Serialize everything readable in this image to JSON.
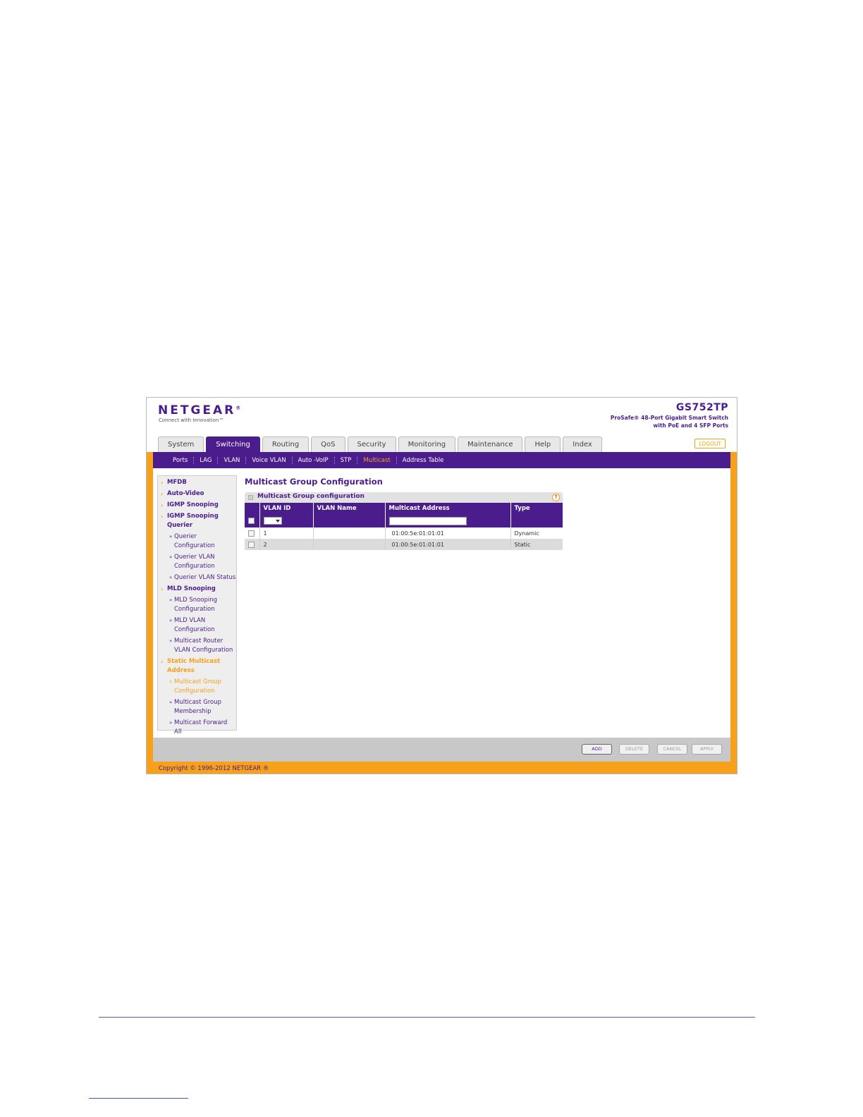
{
  "header": {
    "brand": "NETGEAR",
    "brand_mark": "®",
    "tagline": "Connect with Innovation™",
    "model": "GS752TP",
    "model_desc_line1": "ProSafe® 48-Port Gigabit Smart Switch",
    "model_desc_line2": "with PoE and 4 SFP Ports",
    "logout_label": "LOGOUT"
  },
  "tabs": [
    {
      "label": "System"
    },
    {
      "label": "Switching"
    },
    {
      "label": "Routing"
    },
    {
      "label": "QoS"
    },
    {
      "label": "Security"
    },
    {
      "label": "Monitoring"
    },
    {
      "label": "Maintenance"
    },
    {
      "label": "Help"
    },
    {
      "label": "Index"
    }
  ],
  "active_tab": "Switching",
  "subnav": [
    {
      "label": "Ports"
    },
    {
      "label": "LAG"
    },
    {
      "label": "VLAN"
    },
    {
      "label": "Voice VLAN"
    },
    {
      "label": "Auto -VoIP"
    },
    {
      "label": "STP"
    },
    {
      "label": "Multicast"
    },
    {
      "label": "Address Table"
    }
  ],
  "active_subnav": "Multicast",
  "sidebar": [
    {
      "label": "MFDB",
      "level": 1
    },
    {
      "label": "Auto-Video",
      "level": 1
    },
    {
      "label": "IGMP Snooping",
      "level": 1
    },
    {
      "label": "IGMP Snooping Querier",
      "level": 1
    },
    {
      "label": "Querier Configuration",
      "level": 2
    },
    {
      "label": "Querier VLAN Configuration",
      "level": 2
    },
    {
      "label": "Querier VLAN Status",
      "level": 2
    },
    {
      "label": "MLD Snooping",
      "level": 1
    },
    {
      "label": "MLD Snooping Configuration",
      "level": 2
    },
    {
      "label": "MLD VLAN Configuration",
      "level": 2
    },
    {
      "label": "Multicast Router VLAN Configuration",
      "level": 2
    },
    {
      "label": "Static Multicast Address",
      "level": 1
    },
    {
      "label": "Multicast Group Configuration",
      "level": 2
    },
    {
      "label": "Multicast Group Membership",
      "level": 2
    },
    {
      "label": "Multicast Forward All",
      "level": 2
    }
  ],
  "sidebar_active": [
    "Static Multicast Address",
    "Multicast Group Configuration"
  ],
  "main": {
    "page_title": "Multicast Group Configuration",
    "panel_title": "Multicast Group configuration",
    "help_glyph": "?",
    "columns": [
      "VLAN ID",
      "VLAN Name",
      "Multicast Address",
      "Type"
    ],
    "rows": [
      {
        "vlan_id": "1",
        "vlan_name": "",
        "address": "01:00:5e:01:01:01",
        "type": "Dynamic"
      },
      {
        "vlan_id": "2",
        "vlan_name": "",
        "address": "01:00:5e:01:01:01",
        "type": "Static"
      }
    ]
  },
  "buttons": {
    "add": "ADD",
    "delete": "DELETE",
    "cancel": "CANCEL",
    "apply": "APPLY"
  },
  "footer": {
    "copyright": "Copyright © 1996-2012 NETGEAR ®"
  },
  "colors": {
    "brand_purple": "#4b1d8c",
    "accent_orange": "#f7a01c"
  }
}
